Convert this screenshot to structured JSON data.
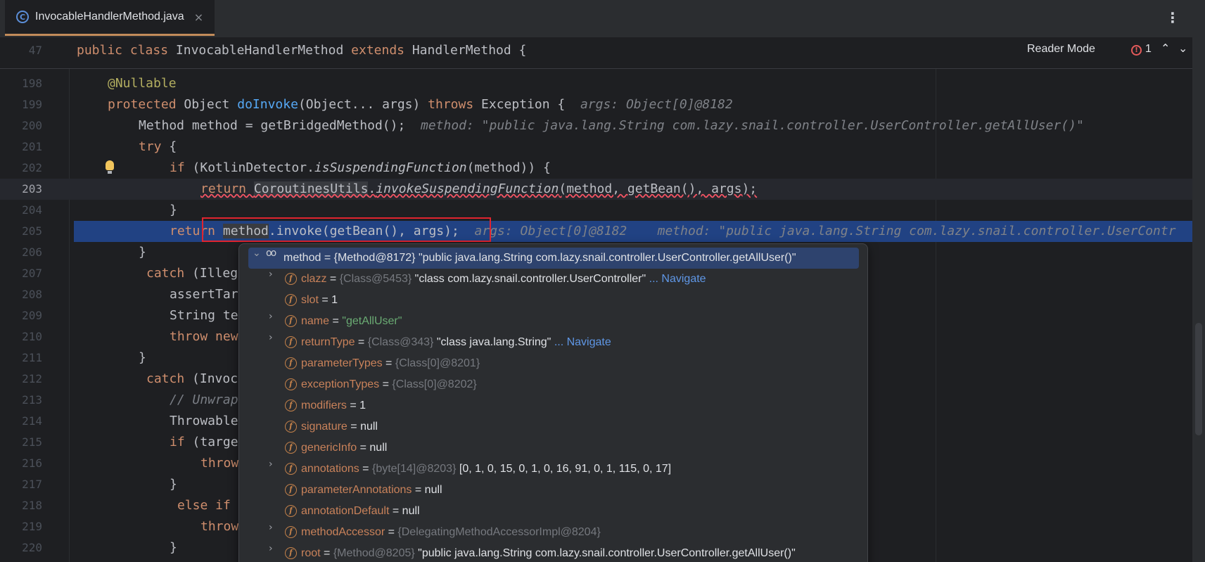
{
  "tab": {
    "icon": "class-c-icon",
    "label": "InvocableHandlerMethod.java",
    "close": "×"
  },
  "toolbar": {
    "menu": "⋮",
    "reader_mode": "Reader Mode",
    "error_count": "1",
    "error_icon": "!"
  },
  "sticky": {
    "line": "47",
    "code_kw1": "public class ",
    "code_name": "InvocableHandlerMethod ",
    "code_kw2": "extends ",
    "code_rest": "HandlerMethod {"
  },
  "code": {
    "n198": "198",
    "n199": "199",
    "n200": "200",
    "n201": "201",
    "n202": "202",
    "n203": "203",
    "n204": "204",
    "n205": "205",
    "n206": "206",
    "n207": "207",
    "n208": "208",
    "n209": "209",
    "n210": "210",
    "n211": "211",
    "n212": "212",
    "n213": "213",
    "n214": "214",
    "n215": "215",
    "n216": "216",
    "n217": "217",
    "n218": "218",
    "n219": "219",
    "n220": "220",
    "l198_ann": "@Nullable",
    "l199_kw": "protected ",
    "l199_a": "Object ",
    "l199_fn": "doInvoke",
    "l199_b": "(Object... args) ",
    "l199_kw2": "throws ",
    "l199_c": "Exception {",
    "l199_hint": "args: Object[0]@8182",
    "l200_code": "Method method = getBridgedMethod();",
    "l200_hint": "method: \"public java.lang.String com.lazy.snail.controller.UserController.getAllUser()\"",
    "l201_kw": "try ",
    "l201_b": "{",
    "l202_kw": "if ",
    "l202_a": "(KotlinDetector.",
    "l202_it": "isSuspendingFunction",
    "l202_b": "(method)) {",
    "l203_kw": "return ",
    "l203_cls": "CoroutinesUtils",
    "l203_dot": ".",
    "l203_it": "invokeSuspendingFunction",
    "l203_b": "(method, getBean(), args);",
    "l204": "}",
    "l205_kw": "return ",
    "l205_m": "method",
    "l205_b": ".invoke(getBean(), args);",
    "l205_hint1": "args: Object[0]@8182",
    "l205_hint2": "method: \"public java.lang.String com.lazy.snail.controller.UserContr",
    "l206": "}",
    "l207_kw": "catch ",
    "l207_b": "(Illeg",
    "l208": "assertTar",
    "l209": "String te",
    "l210_kw": "throw new",
    "l211": "}",
    "l212_kw": "catch ",
    "l212_b": "(Invoc",
    "l213": "// Unwrap",
    "l214": "Throwable",
    "l215_kw": "if ",
    "l215_b": "(targe",
    "l216_kw": "throw",
    "l217": "}",
    "l218_kw": "else if",
    "l219_kw": "throw",
    "l220": "}"
  },
  "debug_popup": {
    "root": {
      "name": "method",
      "ref": "{Method@8172}",
      "value": "\"public java.lang.String com.lazy.snail.controller.UserController.getAllUser()\""
    },
    "fields": [
      {
        "name": "clazz",
        "ref": "{Class@5453}",
        "value": "\"class com.lazy.snail.controller.UserController\"",
        "nav": "... Navigate",
        "expandable": true
      },
      {
        "name": "slot",
        "value": "1",
        "expandable": false
      },
      {
        "name": "name",
        "value": "\"getAllUser\"",
        "expandable": true
      },
      {
        "name": "returnType",
        "ref": "{Class@343}",
        "value": "\"class java.lang.String\"",
        "nav": "... Navigate",
        "expandable": true
      },
      {
        "name": "parameterTypes",
        "ref": "{Class[0]@8201}",
        "expandable": false
      },
      {
        "name": "exceptionTypes",
        "ref": "{Class[0]@8202}",
        "expandable": false
      },
      {
        "name": "modifiers",
        "value": "1",
        "expandable": false
      },
      {
        "name": "signature",
        "value": "null",
        "expandable": false
      },
      {
        "name": "genericInfo",
        "value": "null",
        "expandable": false
      },
      {
        "name": "annotations",
        "ref": "{byte[14]@8203}",
        "value": "[0, 1, 0, 15, 0, 1, 0, 16, 91, 0, 1, 115, 0, 17]",
        "expandable": true
      },
      {
        "name": "parameterAnnotations",
        "value": "null",
        "expandable": false
      },
      {
        "name": "annotationDefault",
        "value": "null",
        "expandable": false
      },
      {
        "name": "methodAccessor",
        "ref": "{DelegatingMethodAccessorImpl@8204}",
        "expandable": true
      },
      {
        "name": "root",
        "ref": "{Method@8205}",
        "value": "\"public java.lang.String com.lazy.snail.controller.UserController.getAllUser()\"",
        "expandable": true
      }
    ],
    "field_icon": "f",
    "equals": " = "
  }
}
